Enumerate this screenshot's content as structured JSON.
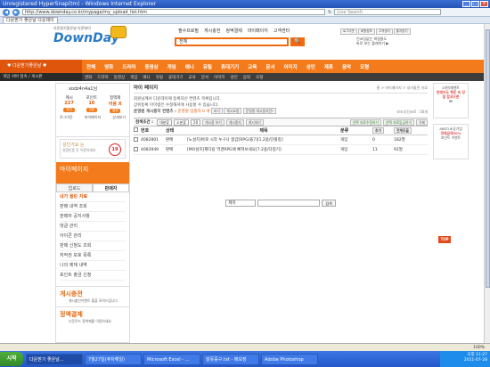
{
  "window": {
    "title": "Unregistered HyperSnap(tm) - Windows Internet Explorer",
    "min": "_",
    "max": "□",
    "close": "×"
  },
  "browser": {
    "url": "http://www.downday.co.kr/mypage/my_upload_list.htm",
    "search_placeholder": "Live Search",
    "tab_title": "다운받기 좋은날 다운데이"
  },
  "site": {
    "logo_small": "다운받기좋은날 다운데이",
    "logo_text": "DownDay",
    "top_menu": [
      "필수프로필",
      "게시충전",
      "정액결제",
      "마이페이지",
      "고객센터"
    ],
    "search_value": "전체",
    "search_button": "🔍",
    "util_links": [
      "로그아웃",
      "회원정보",
      "고객센터",
      "즐겨찾기"
    ],
    "promo_line1": "인코딩없는 파일들도",
    "promo_line2": "바로 보는 플레이기 ▶",
    "nav_left": "♥ 다운받기좋은날 ♥",
    "main_nav": [
      "전체",
      "영화",
      "드라마",
      "동영상",
      "게임",
      "애니",
      "유틸",
      "휴대기기",
      "교육",
      "문서",
      "이미지",
      "성인",
      "제휴",
      "음악",
      "모형"
    ],
    "subnav_left": "게임 서버 접속 / 게시판",
    "sub_nav": [
      "영화",
      "드라마",
      "동영상",
      "게임",
      "애니",
      "유틸",
      "휴대기기",
      "교육",
      "문서",
      "이미지",
      "성인",
      "음악",
      "모형"
    ]
  },
  "sidebar": {
    "username": "xodz4n4a1님",
    "stats": [
      {
        "label": "캐시",
        "value": "227",
        "btn": "충전"
      },
      {
        "label": "포인트",
        "value": "10",
        "btn": "전환"
      },
      {
        "label": "정액제",
        "value": "이용 X",
        "btn": "결제"
      }
    ],
    "links": [
      "로그아웃",
      "마이페이지",
      "상세보기"
    ],
    "cert_title": "성인가요 는",
    "cert_sub": "실명인증 후 이용하세요",
    "cert_badge": "19",
    "mypage_title": "마이페이지",
    "tabs": [
      "업로드",
      "판매자"
    ],
    "menu": [
      "내가 올린 자료",
      "판매 내역 조회",
      "판매자 공지사항",
      "댓글 관리",
      "아이콘 관리",
      "판매 신청도 조회",
      "저작권 보호 목록",
      "나의 제재 내역",
      "포인트 출금 신청"
    ],
    "extra1_title": "게시충전",
    "extra1_desc": "캐시할인이벤트 폴을 모아드립니다",
    "extra2_title": "정액결제",
    "extra2_desc": "다운로드 정액제를 이용하세요"
  },
  "content": {
    "title": "마이 페이지",
    "breadcrumb": "홈 > 마이페이지 > 내가올린 자료",
    "notice1": "회원님께서 다운데이에 등록하신 컨텐츠 목록입니다.",
    "notice2": "상위등록 아이템은 수정해서에 사용할 수 있습니다.",
    "notice3_label": "운영원 게시중지 컨텐츠 :",
    "notice3_value": "운영원 임총자 0 개",
    "notice3_btn1": "보기",
    "notice3_btn2": "게시요청",
    "notice3_btn3": "운영원 게시중지란?",
    "right_info": "보조추진코로 : 50개",
    "toolbar": {
      "label": "검색조건 :",
      "sel1": "대분류",
      "sel2": "소분류",
      "sel3": "20",
      "btns": [
        "게시중 보기",
        "게시중지",
        "게시처리"
      ],
      "right_btns": [
        "선택 자료수정하기",
        "선택 자료입금하기",
        "삭제"
      ]
    },
    "columns": [
      "번호",
      "상태",
      "제목",
      "분류",
      "가격",
      "용량"
    ],
    "add_btn": "추가",
    "edit_btn": "전체모을",
    "rows": [
      {
        "no": "4082801",
        "status": "판매",
        "title": "[노설치]바로 시작 누구나 합갑[RPG/올7][1.2용/단볼칭]",
        "cat": "게임",
        "price": "0",
        "size": "182멀"
      },
      {
        "no": "4083949",
        "status": "판매",
        "title": "[MO설치]제다용 역경RPG에 빠져보세요[7.2용/다칭기]",
        "cat": "게임",
        "price": "11",
        "size": "91멀"
      }
    ],
    "bottom_select": "제목",
    "bottom_btn": "검색"
  },
  "banners": [
    {
      "top": "4개이메벤트",
      "hi": "판매자도 행운 속 당첨 함코드론",
      "sub": "₩"
    },
    {
      "top": "ABSTUE공기업",
      "hi": "경제금액50%",
      "sub": "포인트 이벤트"
    }
  ],
  "top_button": "TOP",
  "statusbar": {
    "left": "",
    "zoom": "100%"
  },
  "taskbar": {
    "start": "시작",
    "tasks": [
      "다운받기 좋은날...",
      "7월27일(주차해일)",
      "Microsoft Excel - ...",
      "잘못증구.txt - 메모장",
      "Adobe Photoshop"
    ],
    "clock": "오후 11:27",
    "date": "2011-07-28"
  }
}
